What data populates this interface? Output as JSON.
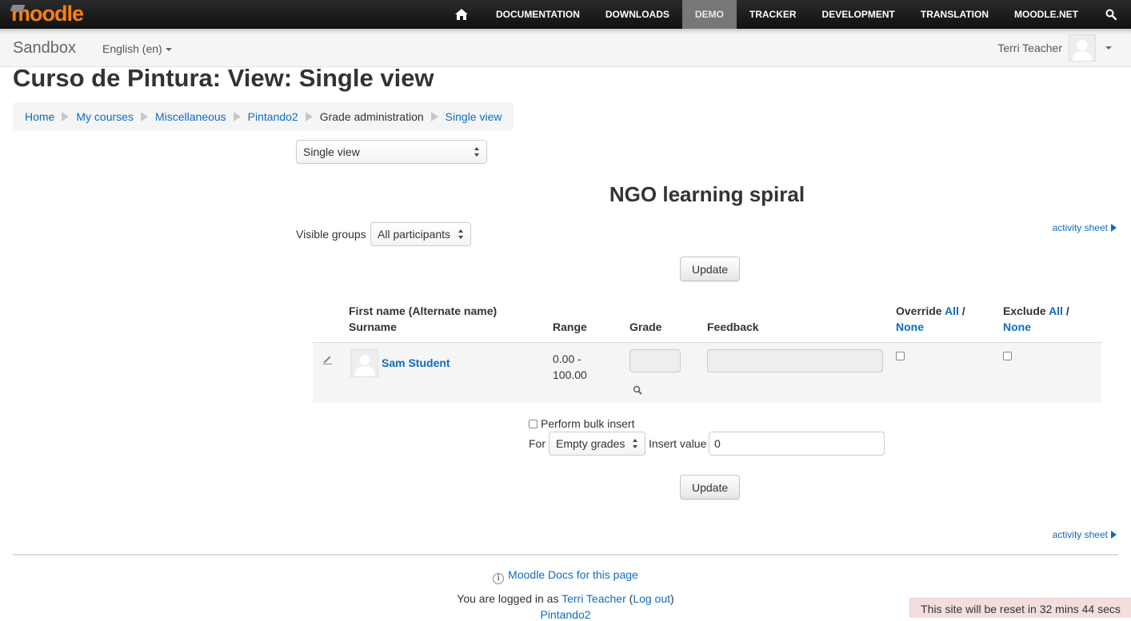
{
  "topnav": {
    "logo": "moodle",
    "items": [
      {
        "label": "DOCUMENTATION"
      },
      {
        "label": "DOWNLOADS"
      },
      {
        "label": "DEMO",
        "active": true
      },
      {
        "label": "TRACKER"
      },
      {
        "label": "DEVELOPMENT"
      },
      {
        "label": "TRANSLATION"
      },
      {
        "label": "MOODLE.NET"
      }
    ],
    "icons": [
      "home-icon",
      "search-icon"
    ]
  },
  "subbar": {
    "brand": "Sandbox",
    "language": "English (en)",
    "user_name": "Terri Teacher"
  },
  "page": {
    "title": "Curso de Pintura: View: Single view",
    "breadcrumb": [
      {
        "label": "Home",
        "link": true
      },
      {
        "label": "My courses",
        "link": true
      },
      {
        "label": "Miscellaneous",
        "link": true
      },
      {
        "label": "Pintando2",
        "link": true
      },
      {
        "label": "Grade administration",
        "link": false
      },
      {
        "label": "Single view",
        "link": true
      }
    ],
    "view_select": "Single view",
    "item_heading": "NGO learning spiral",
    "activity_link": "activity sheet",
    "visible_groups_label": "Visible groups",
    "visible_groups_value": "All participants",
    "update_label": "Update"
  },
  "table": {
    "headers": {
      "name_line1": "First name (Alternate name)",
      "name_line2": "Surname",
      "range": "Range",
      "grade": "Grade",
      "feedback": "Feedback",
      "override": "Override",
      "exclude": "Exclude",
      "all": "All",
      "slash": " /",
      "none": "None"
    },
    "rows": [
      {
        "student": "Sam Student",
        "range_line1": "0.00 -",
        "range_line2": "100.00",
        "grade": "",
        "feedback": "",
        "override": false,
        "exclude": false
      }
    ]
  },
  "bulk": {
    "perform_label": "Perform bulk insert",
    "for_label": "For",
    "for_value": "Empty grades",
    "insert_label": "Insert value",
    "insert_value": "0"
  },
  "footer": {
    "docs_link": "Moodle Docs for this page",
    "logged_prefix": "You are logged in as ",
    "logged_user": "Terri Teacher",
    "logout": "Log out",
    "open_paren": " (",
    "close_paren": ")",
    "course_link": "Pintando2",
    "reset_notice": "This site will be reset in 32 mins 44 secs"
  },
  "colors": {
    "link": "#0f6cbf",
    "logo": "#f98012",
    "topbar": "#1a1a1a",
    "active_nav": "#777777",
    "reset_bg": "#f2dede"
  }
}
